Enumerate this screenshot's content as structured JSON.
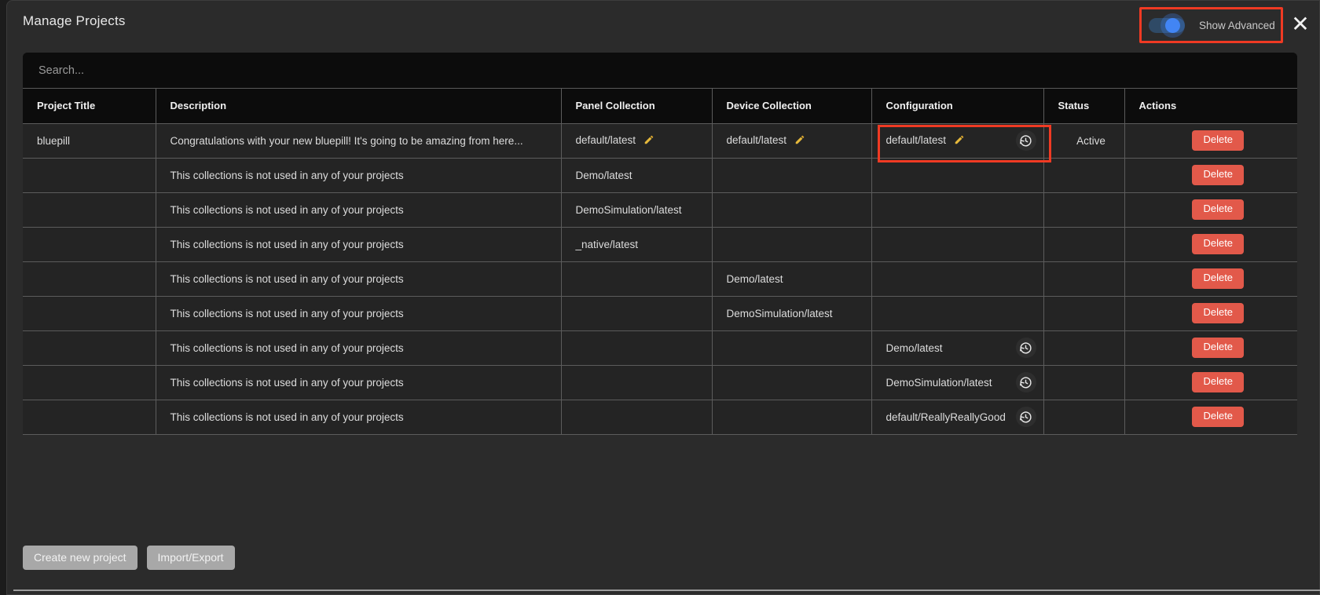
{
  "dialog": {
    "title": "Manage Projects",
    "close_icon": "close-icon"
  },
  "header": {
    "toggle": {
      "label": "Show Advanced",
      "state": "on",
      "accent_color": "#4285f4",
      "highlight_color": "#f03a23"
    }
  },
  "search": {
    "placeholder": "Search...",
    "value": ""
  },
  "table": {
    "columns": [
      "Project Title",
      "Description",
      "Panel Collection",
      "Device Collection",
      "Configuration",
      "Status",
      "Actions"
    ],
    "rows": [
      {
        "project_title": "bluepill",
        "title_state": "green",
        "description": "Congratulations with your new bluepill! It's going to be amazing from here...",
        "panel_collection": "default/latest",
        "panel_state": "olive",
        "panel_edit_icon": "pencil-icon",
        "device_collection": "default/latest",
        "device_state": "olive",
        "device_edit_icon": "pencil-icon",
        "configuration": "default/latest",
        "config_state": "olive",
        "config_edit_icon": "pencil-icon",
        "config_history_icon": "history-icon",
        "status": "Active",
        "status_state": "green",
        "action": "Delete",
        "highlighted": true
      },
      {
        "project_title": "",
        "title_state": "plain",
        "description": "This collections is not used in any of your projects",
        "panel_collection": "Demo/latest",
        "panel_state": "slate",
        "device_collection": "",
        "device_state": "plain",
        "configuration": "",
        "config_state": "plain",
        "status": "",
        "status_state": "plain",
        "action": "Delete"
      },
      {
        "project_title": "",
        "title_state": "plain",
        "description": "This collections is not used in any of your projects",
        "panel_collection": "DemoSimulation/latest",
        "panel_state": "slate",
        "device_collection": "",
        "device_state": "plain",
        "configuration": "",
        "config_state": "plain",
        "status": "",
        "status_state": "plain",
        "action": "Delete"
      },
      {
        "project_title": "",
        "title_state": "plain",
        "description": "This collections is not used in any of your projects",
        "panel_collection": "_native/latest",
        "panel_state": "slate",
        "device_collection": "",
        "device_state": "plain",
        "configuration": "",
        "config_state": "plain",
        "status": "",
        "status_state": "plain",
        "action": "Delete"
      },
      {
        "project_title": "",
        "title_state": "plain",
        "description": "This collections is not used in any of your projects",
        "panel_collection": "",
        "panel_state": "plain",
        "device_collection": "Demo/latest",
        "device_state": "slate",
        "configuration": "",
        "config_state": "plain",
        "status": "",
        "status_state": "plain",
        "action": "Delete"
      },
      {
        "project_title": "",
        "title_state": "plain",
        "description": "This collections is not used in any of your projects",
        "panel_collection": "",
        "panel_state": "plain",
        "device_collection": "DemoSimulation/latest",
        "device_state": "slate",
        "configuration": "",
        "config_state": "plain",
        "status": "",
        "status_state": "plain",
        "action": "Delete"
      },
      {
        "project_title": "",
        "title_state": "plain",
        "description": "This collections is not used in any of your projects",
        "panel_collection": "",
        "panel_state": "plain",
        "device_collection": "",
        "device_state": "plain",
        "configuration": "Demo/latest",
        "config_state": "slate",
        "config_history_icon": "history-icon",
        "status": "",
        "status_state": "plain",
        "action": "Delete"
      },
      {
        "project_title": "",
        "title_state": "plain",
        "description": "This collections is not used in any of your projects",
        "panel_collection": "",
        "panel_state": "plain",
        "device_collection": "",
        "device_state": "plain",
        "configuration": "DemoSimulation/latest",
        "config_state": "slate",
        "config_history_icon": "history-icon",
        "status": "",
        "status_state": "plain",
        "action": "Delete"
      },
      {
        "project_title": "",
        "title_state": "plain",
        "description": "This collections is not used in any of your projects",
        "panel_collection": "",
        "panel_state": "plain",
        "device_collection": "",
        "device_state": "plain",
        "configuration": "default/ReallyReallyGood",
        "config_state": "slate",
        "config_history_icon": "history-icon",
        "status": "",
        "status_state": "plain",
        "action": "Delete"
      }
    ]
  },
  "footer": {
    "create_label": "Create new project",
    "import_export_label": "Import/Export"
  },
  "colors": {
    "active_green": "#2f6e24",
    "olive": "#5d5c33",
    "slate": "#5a5a77",
    "delete_red": "#e2594a",
    "pencil_gold": "#e6b93c",
    "highlight_red": "#f03a23"
  }
}
